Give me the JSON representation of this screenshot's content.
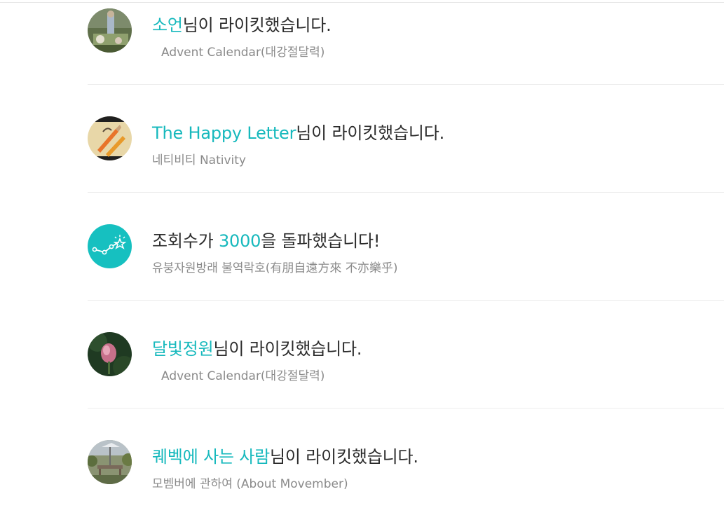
{
  "notifications": [
    {
      "accent": "소언",
      "rest": "님이 라이킷했습니다.",
      "sub": "Advent Calendar(대강절달력)",
      "avatar": "garden-photo"
    },
    {
      "accent": "The Happy Letter",
      "rest": "님이 라이킷했습니다.",
      "sub": "네티비티 Nativity",
      "avatar": "pencils-photo"
    },
    {
      "prefix": "조회수가 ",
      "accent": "3000",
      "rest": "을 돌파했습니다!",
      "sub": "유붕자원방래 불역락호(有朋自遠方來 不亦樂乎)",
      "avatar": "views-milestone-icon"
    },
    {
      "accent": "달빛정원",
      "rest": "님이 라이킷했습니다.",
      "sub": "Advent Calendar(대강절달력)",
      "avatar": "flower-photo"
    },
    {
      "accent": "퀘벡에 사는 사람",
      "rest": "님이 라이킷했습니다.",
      "sub": "모벰버에 관하여 (About Movember)",
      "avatar": "patio-photo"
    }
  ],
  "colors": {
    "accent": "#17b9bd",
    "text": "#2b2b2b",
    "sub": "#8a8a8a"
  }
}
